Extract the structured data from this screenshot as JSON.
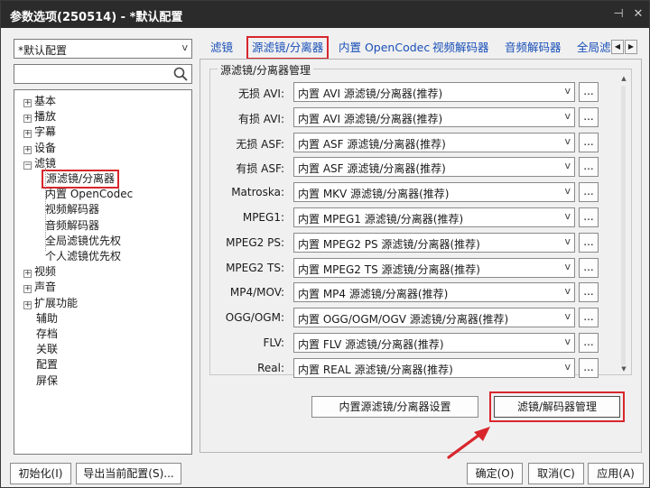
{
  "window": {
    "title": "参数选项(250514) - *默认配置",
    "pin_glyph": "⊣",
    "close_glyph": "✕"
  },
  "left": {
    "profile_value": "*默认配置",
    "search_placeholder": "",
    "tree": [
      {
        "label": "基本",
        "expander": "+"
      },
      {
        "label": "播放",
        "expander": "+"
      },
      {
        "label": "字幕",
        "expander": "+"
      },
      {
        "label": "设备",
        "expander": "+"
      },
      {
        "label": "滤镜",
        "expander": "−"
      },
      {
        "label": "源滤镜/分离器",
        "selected": true
      },
      {
        "label": "内置 OpenCodec"
      },
      {
        "label": "视频解码器"
      },
      {
        "label": "音频解码器"
      },
      {
        "label": "全局滤镜优先权"
      },
      {
        "label": "个人滤镜优先权"
      },
      {
        "label": "视频",
        "expander": "+"
      },
      {
        "label": "声音",
        "expander": "+"
      },
      {
        "label": "扩展功能",
        "expander": "+"
      },
      {
        "label": "辅助"
      },
      {
        "label": "存档"
      },
      {
        "label": "关联"
      },
      {
        "label": "配置"
      },
      {
        "label": "屏保"
      }
    ]
  },
  "tabs": [
    "滤镜",
    "源滤镜/分离器",
    "内置 OpenCodec",
    "视频解码器",
    "音频解码器",
    "全局滤"
  ],
  "group_title": "源滤镜/分离器管理",
  "rows": [
    {
      "label": "无损 AVI:",
      "value": "内置 AVI 源滤镜/分离器(推荐)"
    },
    {
      "label": "有损 AVI:",
      "value": "内置 AVI 源滤镜/分离器(推荐)"
    },
    {
      "label": "无损 ASF:",
      "value": "内置 ASF 源滤镜/分离器(推荐)"
    },
    {
      "label": "有损 ASF:",
      "value": "内置 ASF 源滤镜/分离器(推荐)"
    },
    {
      "label": "Matroska:",
      "value": "内置 MKV 源滤镜/分离器(推荐)"
    },
    {
      "label": "MPEG1:",
      "value": "内置 MPEG1 源滤镜/分离器(推荐)"
    },
    {
      "label": "MPEG2 PS:",
      "value": "内置 MPEG2 PS 源滤镜/分离器(推荐)"
    },
    {
      "label": "MPEG2 TS:",
      "value": "内置 MPEG2 TS 源滤镜/分离器(推荐)"
    },
    {
      "label": "MP4/MOV:",
      "value": "内置 MP4 源滤镜/分离器(推荐)"
    },
    {
      "label": "OGG/OGM:",
      "value": "内置 OGG/OGM/OGV 源滤镜/分离器(推荐)"
    },
    {
      "label": "FLV:",
      "value": "内置 FLV 源滤镜/分离器(推荐)"
    },
    {
      "label": "Real:",
      "value": "内置 REAL 源滤镜/分离器(推荐)"
    }
  ],
  "more_label": "...",
  "buttons": {
    "builtin_settings": "内置源滤镜/分离器设置",
    "filter_manager": "滤镜/解码器管理",
    "reset": "初始化(I)",
    "export": "导出当前配置(S)...",
    "ok": "确定(O)",
    "cancel": "取消(C)",
    "apply": "应用(A)"
  },
  "colors": {
    "highlight": "#d8262c",
    "tab_text": "#1a50b8",
    "titlebar": "#2b2b2b"
  }
}
